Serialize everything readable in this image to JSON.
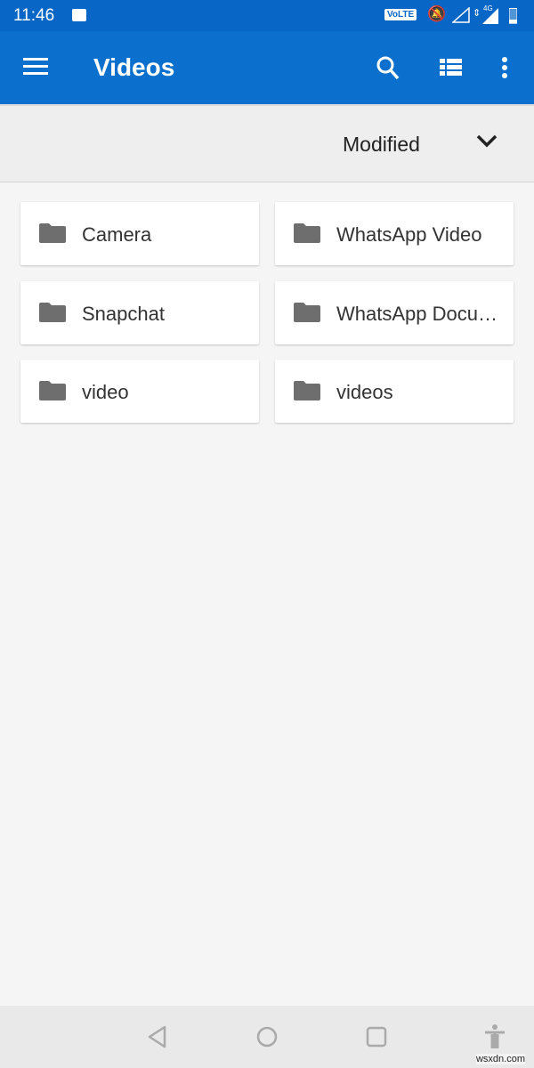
{
  "status_bar": {
    "time": "11:46",
    "network_badge": "VoLTE",
    "network_type": "4G",
    "icons": [
      "image-icon",
      "notifications-off-icon",
      "signal-icon",
      "data-arrows-icon",
      "signal-roaming-icon",
      "battery-icon"
    ]
  },
  "app_bar": {
    "title": "Videos",
    "icons": [
      "menu-icon",
      "search-icon",
      "list-view-icon",
      "more-options-icon"
    ],
    "color": "#0a6fcd"
  },
  "sort": {
    "label": "Modified"
  },
  "folders": [
    {
      "name": "Camera"
    },
    {
      "name": "WhatsApp Video"
    },
    {
      "name": "Snapchat"
    },
    {
      "name": "WhatsApp Documents"
    },
    {
      "name": "video"
    },
    {
      "name": "videos"
    }
  ],
  "nav_bar": {
    "icons": [
      "back-icon",
      "home-icon",
      "recents-icon",
      "accessibility-icon"
    ]
  },
  "watermark": "wsxdn.com"
}
